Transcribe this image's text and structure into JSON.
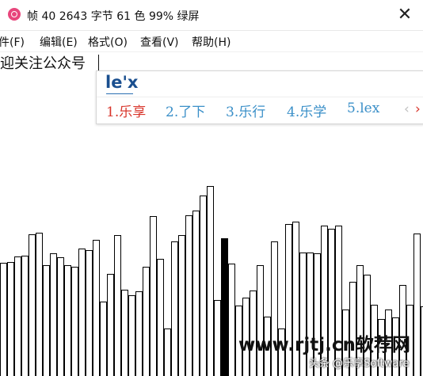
{
  "window": {
    "title": "帧 40 2643 字节 61 色 99% 绿屏",
    "close_glyph": "✕",
    "icon": "camera-icon"
  },
  "menu": {
    "items": [
      {
        "label": "件(F)"
      },
      {
        "label": "编辑(E)"
      },
      {
        "label": "格式(O)"
      },
      {
        "label": "查看(V)"
      },
      {
        "label": "帮助(H)"
      }
    ]
  },
  "editor": {
    "text": "迎关注公众号"
  },
  "ime": {
    "composition": "le'x",
    "candidates": [
      {
        "label": "1.乐享"
      },
      {
        "label": "2.了下"
      },
      {
        "label": "3.乐行"
      },
      {
        "label": "4.乐学"
      },
      {
        "label": "5.lex"
      }
    ],
    "selected_index": 0,
    "prev_glyph": "‹",
    "next_glyph": "›",
    "colors": {
      "selected": "#d8352b",
      "normal": "#3a8fc8",
      "composition": "#1a4f8f"
    }
  },
  "waveform": {
    "bar_tops": [
      332,
      331,
      324,
      323,
      296,
      294,
      335,
      320,
      325,
      335,
      337,
      314,
      316,
      303,
      381,
      346,
      297,
      366,
      373,
      368,
      337,
      273,
      327,
      415,
      305,
      297,
      272,
      266,
      247,
      235,
      379,
      301,
      333,
      386,
      376,
      367,
      335,
      400,
      305,
      415,
      283,
      280,
      319,
      319,
      320,
      285,
      289,
      285,
      391,
      356,
      335,
      347,
      385,
      403,
      391,
      401,
      360,
      385,
      295,
      387
    ],
    "highlight_index": 31
  },
  "watermark": {
    "main": "www.rjtj.cn软荐网",
    "sub": "头条 @乐享Software"
  }
}
